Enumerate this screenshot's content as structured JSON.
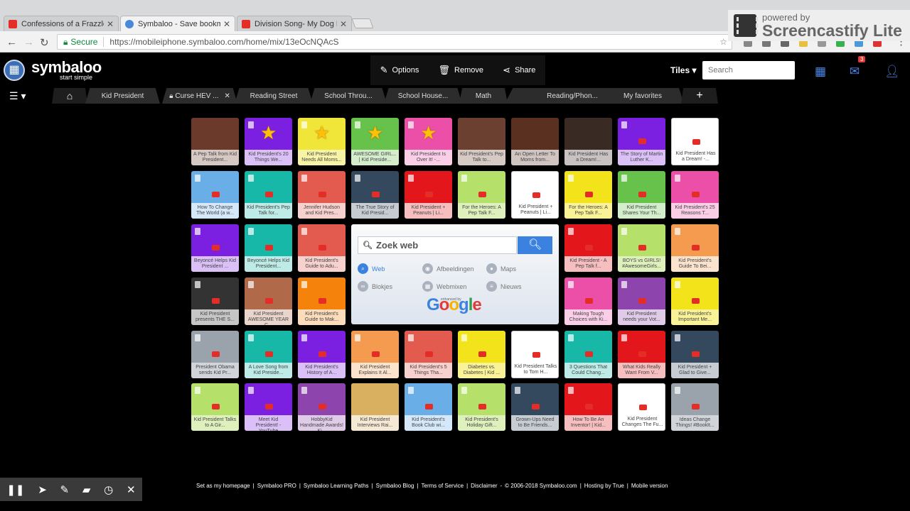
{
  "browser": {
    "tabs": [
      {
        "title": "Confessions of a Frazzled",
        "favicon": "youtube-icon",
        "active": false
      },
      {
        "title": "Symbaloo - Save bookm",
        "favicon": "symbaloo-icon",
        "active": true
      },
      {
        "title": "Division Song- My Dog D",
        "favicon": "youtube-icon",
        "active": false
      }
    ],
    "secure_label": "Secure",
    "url": "https://mobileiphone.symbaloo.com/home/mix/13eOcNQAcS"
  },
  "screencastify": {
    "powered_by": "powered by",
    "name": "Screencastify Lite"
  },
  "header": {
    "brand": "symbaloo",
    "tagline": "start simple",
    "options_label": "Options",
    "remove_label": "Remove",
    "share_label": "Share",
    "tiles_label": "Tiles ▾",
    "search_placeholder": "Search",
    "mail_count": "3"
  },
  "webmixes": [
    "Kid President",
    "Curse HEV ...",
    "Reading Street",
    "School Throu...",
    "School House...",
    "Math",
    "Reading/Phon...",
    "My favorites"
  ],
  "google_widget": {
    "placeholder": "Zoek web",
    "options": [
      "Web",
      "Afbeeldingen",
      "Maps",
      "Blokjes",
      "Webmixen",
      "Nieuws"
    ],
    "enhanced": "enhanced by",
    "brand": "Google"
  },
  "tiles": [
    {
      "label": "A Pep Talk from Kid President...",
      "color": "#6b3a2a",
      "icon": "photo"
    },
    {
      "label": "Kid President's 20 Things We...",
      "color": "#7b1fe0",
      "icon": "star"
    },
    {
      "label": "Kid President Needs All Moms...",
      "color": "#f0e63a",
      "icon": "star"
    },
    {
      "label": "AWESOME GIRL... | Kid Preside...",
      "color": "#66c24a",
      "icon": "star"
    },
    {
      "label": "Kid President Is Over It! -...",
      "color": "#ec4fa8",
      "icon": "star"
    },
    {
      "label": "Kid President's Pep Talk to...",
      "color": "#6b4030",
      "icon": "photo"
    },
    {
      "label": "An Open Letter To Moms from...",
      "color": "#5a3020",
      "icon": "photo"
    },
    {
      "label": "Kid President Has a Dream!...",
      "color": "#3a2a24",
      "icon": "photo"
    },
    {
      "label": "The Story of Martin Luther K...",
      "color": "#7b1fe0",
      "icon": "yt"
    },
    {
      "label": "Kid President Has a Dream! -...",
      "color": "#ffffff",
      "icon": "yt"
    },
    {
      "label": "How To Change The World (a w...",
      "color": "#6aaee8",
      "icon": "yt"
    },
    {
      "label": "Kid President's Pep Talk for...",
      "color": "#18b8a8",
      "icon": "yt"
    },
    {
      "label": "Jennifer Hudson and Kid Pres...",
      "color": "#e35b4f",
      "icon": "yt"
    },
    {
      "label": "The True Story of Kid Presid...",
      "color": "#34495e",
      "icon": "yt"
    },
    {
      "label": "Kid President + Peanuts | Li...",
      "color": "#e3161c",
      "icon": "yt"
    },
    {
      "label": "For the Heroes: A Pep Talk F...",
      "color": "#b5e06a",
      "icon": "yt"
    },
    {
      "label": "Kid President + Peanuts | Li...",
      "color": "#ffffff",
      "icon": "yt"
    },
    {
      "label": "For the Heroes: A Pep Talk F...",
      "color": "#f2e31a",
      "icon": "yt"
    },
    {
      "label": "Kid President Shares Your Th...",
      "color": "#66c24a",
      "icon": "yt"
    },
    {
      "label": "Kid President's 25 Reasons T...",
      "color": "#ec4fa8",
      "icon": "yt"
    },
    {
      "label": "Beyoncé Helps Kid President ...",
      "color": "#7b1fe0",
      "icon": "yt"
    },
    {
      "label": "Beyoncé Helps Kid President...",
      "color": "#18b8a8",
      "icon": "yt"
    },
    {
      "label": "Kid President's Guide to Adu...",
      "color": "#e35b4f",
      "icon": "yt"
    },
    {
      "label": "Kid President - A Pep Talk f...",
      "color": "#e3161c",
      "icon": "yt"
    },
    {
      "label": "BOYS vs GIRLS! #AwesomeGirls...",
      "color": "#b5e06a",
      "icon": "yt"
    },
    {
      "label": "Kid President's Guide To Bei...",
      "color": "#f59b50",
      "icon": "yt"
    },
    {
      "label": "Kid President presents THE S...",
      "color": "#333333",
      "icon": "yt"
    },
    {
      "label": "Kid President AWESOME YEAR C...",
      "color": "#b06a4a",
      "icon": "yt"
    },
    {
      "label": "Kid President's Guide to Mak...",
      "color": "#f5820a",
      "icon": "yt"
    },
    {
      "label": "Making Tough Choices with Ki...",
      "color": "#ec4fa8",
      "icon": "yt"
    },
    {
      "label": "Kid President needs your Vot...",
      "color": "#8e44ad",
      "icon": "yt"
    },
    {
      "label": "Kid President's Important Me...",
      "color": "#f2e31a",
      "icon": "yt"
    },
    {
      "label": "President Obama sends Kid Pr...",
      "color": "#9aa3ab",
      "icon": "yt"
    },
    {
      "label": "A Love Song from Kid Preside...",
      "color": "#18b8a8",
      "icon": "yt"
    },
    {
      "label": "Kid President's History of A...",
      "color": "#7b1fe0",
      "icon": "yt"
    },
    {
      "label": "Kid President Explains It Al...",
      "color": "#f59b50",
      "icon": "yt"
    },
    {
      "label": "Kid President's 5 Things Tha...",
      "color": "#e35b4f",
      "icon": "yt"
    },
    {
      "label": "Diabetes vs. Diabetes | Kid ...",
      "color": "#f2e31a",
      "icon": "yt"
    },
    {
      "label": "Kid President Talks to Tom H...",
      "color": "#ffffff",
      "icon": "yt"
    },
    {
      "label": "3 Questions That Could Chang...",
      "color": "#18b8a8",
      "icon": "yt"
    },
    {
      "label": "What Kids Really Want From V...",
      "color": "#e3161c",
      "icon": "yt"
    },
    {
      "label": "Kid President + Glad to Give...",
      "color": "#34495e",
      "icon": "yt"
    },
    {
      "label": "Kid President Talks to A Gir...",
      "color": "#b5e06a",
      "icon": "yt"
    },
    {
      "label": "Meet Kid President! - YouTube",
      "color": "#7b1fe0",
      "icon": "yt"
    },
    {
      "label": "HobbyKid Handmade Awards! Ki...",
      "color": "#8e44ad",
      "icon": "yt"
    },
    {
      "label": "Kid President Interviews Rai...",
      "color": "#d9b060",
      "icon": "photo"
    },
    {
      "label": "Kid President's Book Club wi...",
      "color": "#6aaee8",
      "icon": "yt"
    },
    {
      "label": "Kid President's Holiday Gift...",
      "color": "#b5e06a",
      "icon": "yt"
    },
    {
      "label": "Grown-Ups Need to Be Friends...",
      "color": "#34495e",
      "icon": "yt"
    },
    {
      "label": "How To Be An Inventor! | Kid...",
      "color": "#e3161c",
      "icon": "yt"
    },
    {
      "label": "Kid President Changes The Fu...",
      "color": "#ffffff",
      "icon": "yt"
    },
    {
      "label": "Ideas Change Things! #BookIt...",
      "color": "#9aa3ab",
      "icon": "yt"
    }
  ],
  "footer": [
    "Set as my homepage",
    "|",
    "Symbaloo PRO",
    "|",
    "Symbaloo Learning Paths",
    "|",
    "Symbaloo Blog",
    "|",
    "Terms of Service",
    "|",
    "Disclaimer",
    "-",
    "© 2006-2018 Symbaloo.com",
    "|",
    "Hosting by True",
    "|",
    "Mobile version"
  ]
}
